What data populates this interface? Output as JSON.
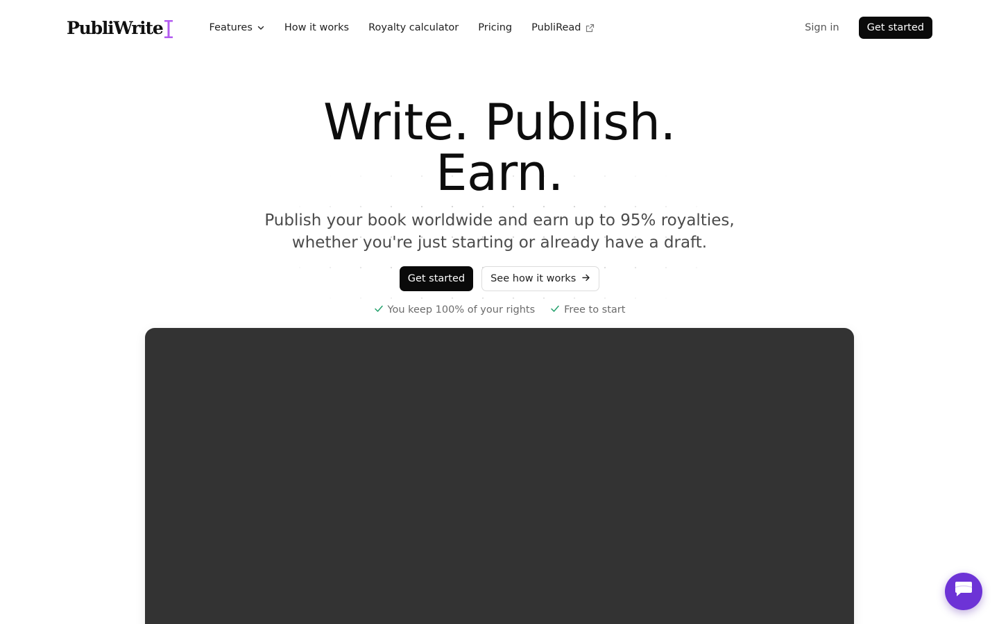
{
  "brand": {
    "name": "PubliWrite",
    "cursor_color": "#b35cf0"
  },
  "nav": {
    "items": [
      {
        "label": "Features",
        "icon": "chevron-down-icon"
      },
      {
        "label": "How it works"
      },
      {
        "label": "Royalty calculator"
      },
      {
        "label": "Pricing"
      },
      {
        "label": "PubliRead",
        "icon": "external-link-icon"
      }
    ],
    "sign_in": "Sign in",
    "get_started": "Get started"
  },
  "hero": {
    "title_line1": "Write. Publish.",
    "title_line2": "Earn.",
    "subtitle_line1": "Publish your book worldwide and earn up to 95% royalties,",
    "subtitle_line2": "whether you're just starting or already have a draft.",
    "primary_cta": "Get started",
    "secondary_cta": "See how it works",
    "secondary_icon": "arrow-right-icon",
    "checks": [
      {
        "label": "You keep 100% of your rights",
        "icon": "check-icon"
      },
      {
        "label": "Free to start",
        "icon": "check-icon"
      }
    ],
    "check_color": "#22a06b"
  },
  "chat": {
    "icon": "chat-icon",
    "color": "#6d33d6"
  }
}
